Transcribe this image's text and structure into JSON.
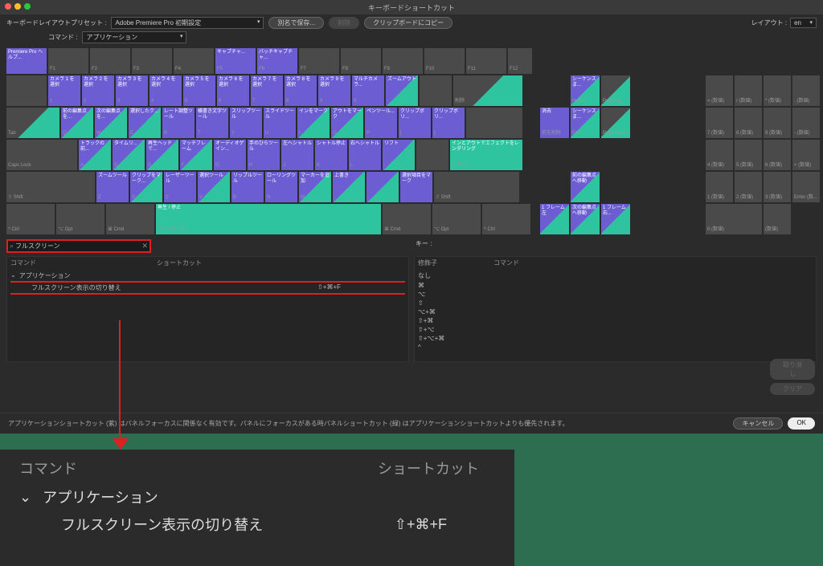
{
  "title": "キーボードショートカット",
  "toolbar": {
    "preset_label": "キーボードレイアウトプリセット :",
    "preset_value": "Adobe Premiere Pro 初期設定",
    "save_as": "別名で保存...",
    "delete": "削除",
    "copy_clip": "クリップボードにコピー",
    "layout_label": "レイアウト :",
    "layout_value": "en",
    "commands_label": "コマンド :",
    "commands_value": "アプリケーション"
  },
  "search": {
    "value": "フルスクリーン"
  },
  "left": {
    "hdr_cmd": "コマンド",
    "hdr_sc": "ショートカット",
    "group": "アプリケーション",
    "item": "フルスクリーン表示の切り替え",
    "item_sc": "⇧+⌘+F"
  },
  "right": {
    "hdr_key": "キー :",
    "hdr_mod": "修飾子",
    "hdr_cmd": "コマンド",
    "mods": [
      "なし",
      "⌘",
      "⌥",
      "⇧",
      "⌥+⌘",
      "⇧+⌘",
      "⇧+⌥",
      "⇧+⌥+⌘",
      "^"
    ]
  },
  "side": {
    "undo": "取り消し",
    "clear": "クリア"
  },
  "footer": {
    "note": "アプリケーションショートカット (紫) はパネルフォーカスに関係なく有効です。パネルにフォーカスがある時パネルショートカット (緑) はアプリケーションショートカットよりも優先されます。",
    "cancel": "キャンセル",
    "ok": "OK"
  },
  "zoom": {
    "hdr_cmd": "コマンド",
    "hdr_sc": "ショートカット",
    "group": "アプリケーション",
    "item": "フルスクリーン表示の切り替え",
    "item_sc": "⇧+⌘+F"
  },
  "keys": {
    "esc": "Premiere Pro ヘルプ...",
    "f5": "キャプチャ...",
    "f6": "バッチキャプチャ...",
    "r1": [
      "カメラ 1 を選択",
      "カメラ 2 を選択",
      "カメラ 3 を選択",
      "カメラ 4 を選択",
      "カメラ 5 を選択",
      "カメラ 6 を選択",
      "カメラ 7 を選択",
      "カメラ 8 を選択",
      "カメラ 9 を選択",
      "マルチカメラ..."
    ],
    "r1_last": "ズームアウト",
    "r1_del": "削除",
    "r2": [
      "前の編集点を...",
      "次の編集点を...",
      "選択したク...",
      "レート調整ツール",
      "横書き文字ツール",
      "スリップツール",
      "スライドツール",
      "インをマーク",
      "アウトをマーク",
      "ペンツール..."
    ],
    "r2_11": "クリップボリ...",
    "r2_12": "クリップボリ...",
    "r3": [
      "トラックの前...",
      "タイムリ...",
      "再生ヘッドで...",
      "マッチフレーム",
      "オーディオゲイン...",
      "手のひらツール",
      "左へシャトル",
      "シャトル停止",
      "右へシャトル",
      "リフト"
    ],
    "r3_ret": "インとアウトでエフェクトをレンダリング",
    "r4": [
      "ズームツール",
      "クリップをマーク...",
      "レーザーツール",
      "選択ツール",
      "リップルツール",
      "ローリングツール",
      "マーカーを追加",
      "上書き"
    ],
    "r4_last": "選択項目をマーク",
    "space": "再生 / 停止",
    "space_sub": "スペースキー",
    "nav": {
      "home": "シーケンスま...",
      "end": "シーケンスま...",
      "pgup": "",
      "pgdn": "Page Down",
      "del": "消去",
      "bksp": "前を削除",
      "e1": "前の編集点へ移動",
      "e2": "1 フレーム左",
      "e3": "次の編集点へ移動",
      "e4": "1 フレーム右..."
    },
    "num_row0": [
      "= (数値)",
      "/ (数値)",
      "* (数値)",
      ". (数値)"
    ],
    "num_row1": [
      "7 (数値)",
      "8 (数値)",
      "9 (数値)"
    ],
    "num_row2": [
      "4 (数値)",
      "5 (数値)",
      "6 (数値)",
      "+ (数値)"
    ],
    "num_row3": [
      "1 (数値)",
      "2 (数値)",
      "3 (数値)"
    ],
    "num_row4": [
      "0 (数値)",
      "(数値)",
      "Enter (数..."
    ],
    "minus": "- (数値)"
  },
  "syskeys": {
    "tab": "Tab",
    "caps": "Caps Lock",
    "shift": "⇧ Shift",
    "ctrl": "^ Ctrl",
    "opt": "⌥ Opt",
    "cmd": "⌘ Cmd",
    "f": [
      "F1",
      "F2",
      "F3",
      "F4",
      "F5",
      "F6",
      "F7",
      "F8",
      "F9",
      "F10",
      "F11",
      "F12"
    ],
    "nums": [
      "1",
      "2",
      "3",
      "4",
      "5",
      "6",
      "7",
      "8",
      "9",
      "0",
      "-"
    ],
    "qrow": [
      "Q",
      "W",
      "E",
      "R",
      "T",
      "Y",
      "U",
      "I",
      "O",
      "P",
      "[",
      "]"
    ],
    "arow": [
      "A",
      "S",
      "D",
      "F",
      "G",
      "H",
      "J",
      "K",
      "L",
      ";"
    ],
    "zrow": [
      "Z",
      "X",
      "C",
      "V",
      "B",
      "N",
      "M",
      ",",
      "."
    ],
    "home": "Home",
    "end": "End",
    "pgup": "Page Up",
    "pgdn": "Page Down",
    "ret": "リターン"
  }
}
